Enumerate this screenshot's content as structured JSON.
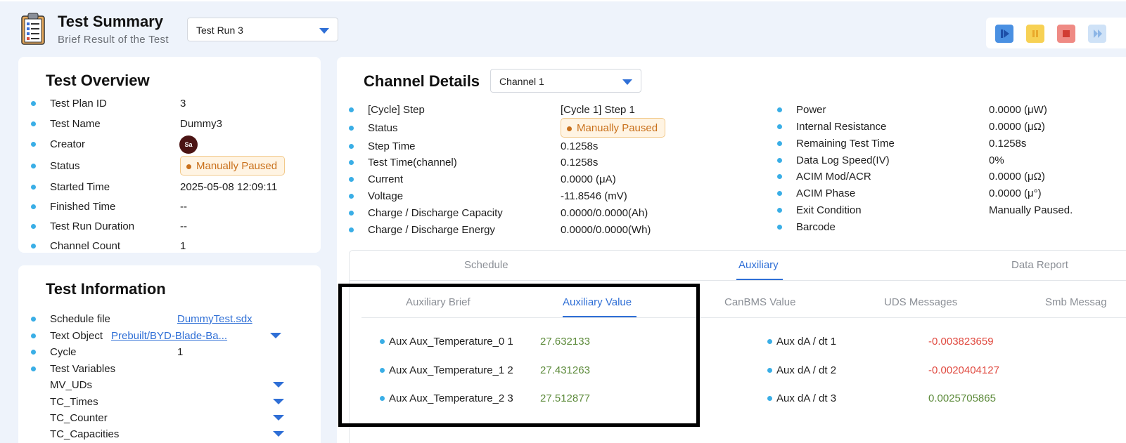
{
  "header": {
    "title": "Test Summary",
    "subtitle": "Brief Result of the Test",
    "test_run_select": "Test Run 3"
  },
  "controls": [
    {
      "name": "start-button",
      "icon": "play-step-icon",
      "color": "#4a90e2"
    },
    {
      "name": "pause-button",
      "icon": "pause-icon",
      "color": "#f7c948"
    },
    {
      "name": "stop-button",
      "icon": "stop-icon",
      "color": "#ec6b6b"
    },
    {
      "name": "skip-button",
      "icon": "skip-forward-icon",
      "color": "#a9cdf2"
    }
  ],
  "overview": {
    "title": "Test Overview",
    "rows": [
      {
        "label": "Test Plan ID",
        "value": "3"
      },
      {
        "label": "Test Name",
        "value": "Dummy3"
      },
      {
        "label": "Creator",
        "value": "Sa"
      },
      {
        "label": "Status",
        "value": "Manually Paused"
      },
      {
        "label": "Started Time",
        "value": "2025-05-08 12:09:11"
      },
      {
        "label": "Finished Time",
        "value": "--"
      },
      {
        "label": "Test Run Duration",
        "value": "--"
      },
      {
        "label": "Channel Count",
        "value": "1"
      }
    ]
  },
  "information": {
    "title": "Test Information",
    "schedule_label": "Schedule file",
    "schedule_value": "DummyTest.sdx",
    "text_object_label": "Text Object",
    "text_object_value": "Prebuilt/BYD-Blade-Ba...",
    "cycle_label": "Cycle",
    "cycle_value": "1",
    "variables_label": "Test Variables",
    "variables": [
      "MV_UDs",
      "TC_Times",
      "TC_Counter",
      "TC_Capacities"
    ]
  },
  "channel": {
    "title": "Channel Details",
    "select": "Channel 1",
    "left": [
      {
        "label": "[Cycle] Step",
        "value": "[Cycle 1] Step 1"
      },
      {
        "label": "Status",
        "value": "Manually Paused"
      },
      {
        "label": "Step Time",
        "value": "0.1258s"
      },
      {
        "label": "Test Time(channel)",
        "value": "0.1258s"
      },
      {
        "label": "Current",
        "value": "0.0000 (μA)"
      },
      {
        "label": "Voltage",
        "value": "-11.8546 (mV)"
      },
      {
        "label": "Charge / Discharge Capacity",
        "value": "0.0000/0.0000(Ah)"
      },
      {
        "label": "Charge / Discharge Energy",
        "value": "0.0000/0.0000(Wh)"
      }
    ],
    "right": [
      {
        "label": "Power",
        "value": "0.0000 (μW)"
      },
      {
        "label": "Internal Resistance",
        "value": "0.0000 (μΩ)"
      },
      {
        "label": "Remaining Test Time",
        "value": "0.1258s"
      },
      {
        "label": "Data Log Speed(IV)",
        "value": "0%"
      },
      {
        "label": "ACIM Mod/ACR",
        "value": "0.0000 (μΩ)"
      },
      {
        "label": "ACIM Phase",
        "value": "0.0000 (μ°)"
      },
      {
        "label": "Exit Condition",
        "value": "Manually Paused."
      },
      {
        "label": "Barcode",
        "value": ""
      }
    ]
  },
  "main_tabs": [
    "Schedule",
    "Auxiliary",
    "Data Report"
  ],
  "sub_tabs": [
    "Auxiliary Brief",
    "Auxiliary Value",
    "CanBMS Value",
    "UDS Messages",
    "Smb Messag"
  ],
  "aux_values": [
    {
      "label": "Aux Aux_Temperature_0 1",
      "value": "27.632133"
    },
    {
      "label": "Aux Aux_Temperature_1 2",
      "value": "27.431263"
    },
    {
      "label": "Aux Aux_Temperature_2 3",
      "value": "27.512877"
    }
  ],
  "aux_rates": [
    {
      "label": "Aux dA / dt 1",
      "value": "-0.003823659",
      "color": "#e0493f"
    },
    {
      "label": "Aux dA / dt 2",
      "value": "-0.0020404127",
      "color": "#e0493f"
    },
    {
      "label": "Aux dA / dt 3",
      "value": "0.0025705865",
      "color": "#5c8a3a"
    }
  ]
}
